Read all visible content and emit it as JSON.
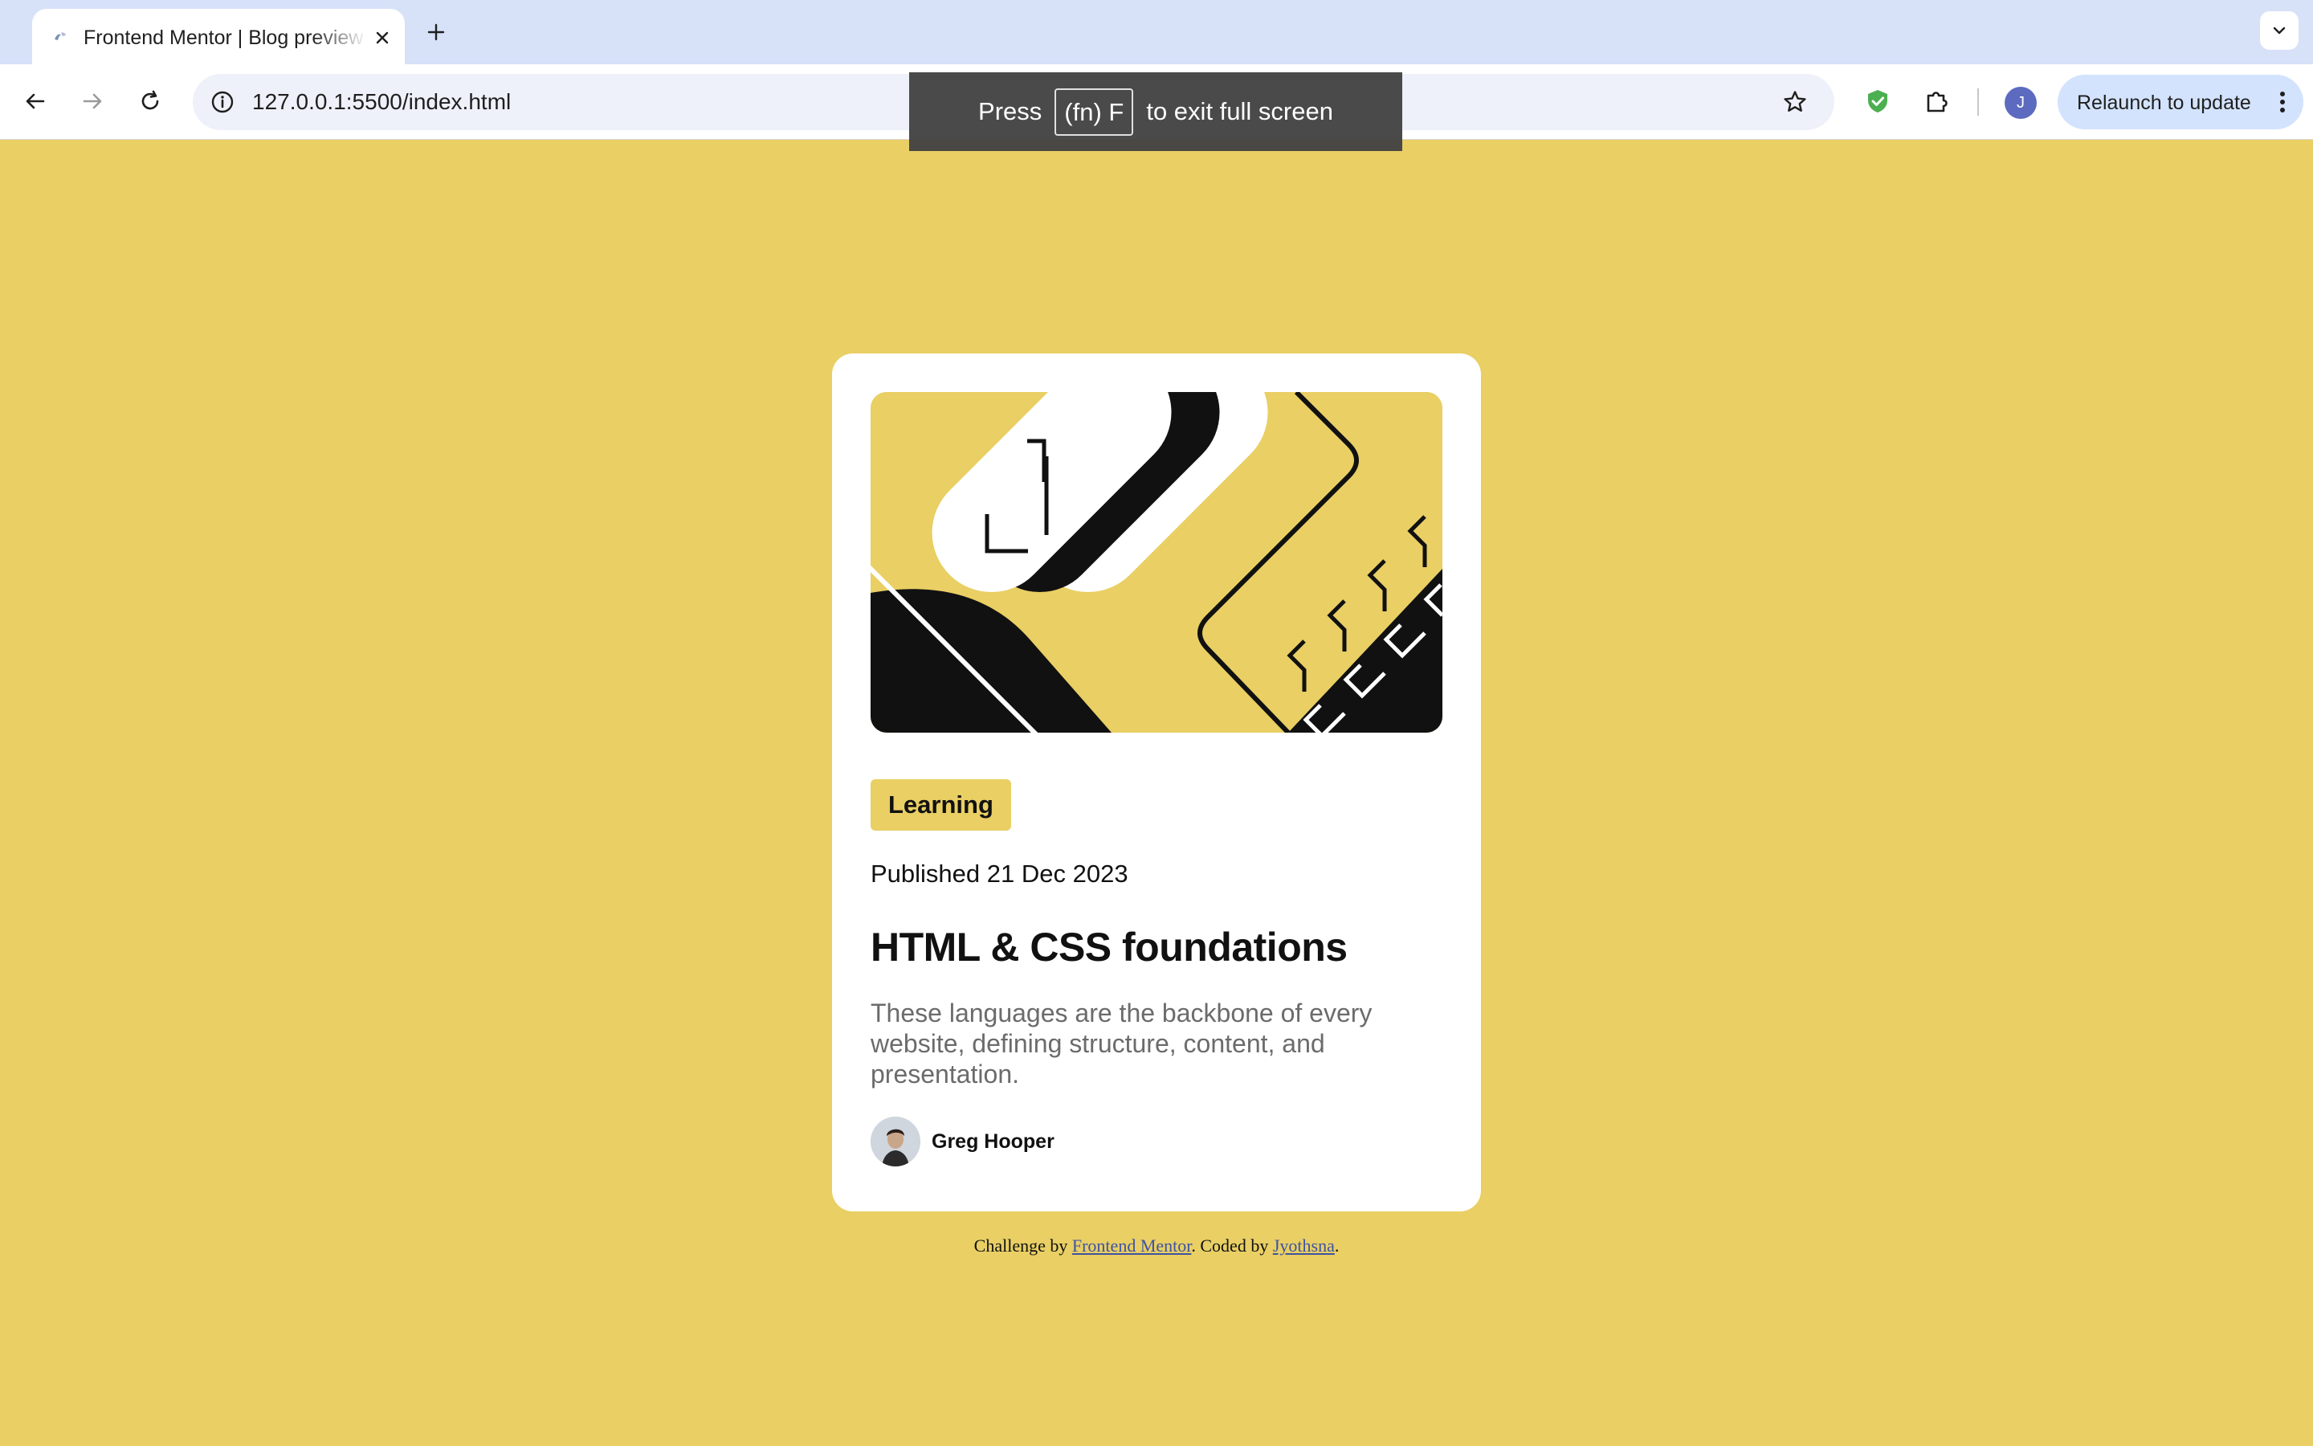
{
  "browser": {
    "tab_title": "Frontend Mentor | Blog preview card main",
    "url": "127.0.0.1:5500/index.html",
    "profile_initial": "J",
    "relaunch_label": "Relaunch to update"
  },
  "fullscreen_toast": {
    "press": "Press",
    "key": "(fn) F",
    "rest": "to exit full screen"
  },
  "card": {
    "tag": "Learning",
    "published": "Published 21 Dec 2023",
    "title": "HTML & CSS foundations",
    "excerpt": "These languages are the backbone of every website, defining structure, content, and presentation.",
    "author": "Greg Hooper"
  },
  "attribution": {
    "prefix": "Challenge by",
    "link1": "Frontend Mentor",
    "middle": ". Coded by",
    "link2": "Jyothsna",
    "suffix": "."
  },
  "colors": {
    "page_background": "#e9cf64",
    "card_background": "#ffffff",
    "tag_background": "#e9cf64",
    "text_primary": "#111111",
    "text_muted": "#6b6b6b"
  },
  "icons": [
    "favicon-icon",
    "close-icon",
    "plus-icon",
    "chevron-down-icon",
    "back-arrow-icon",
    "forward-arrow-icon",
    "reload-icon",
    "info-icon",
    "star-icon",
    "shield-icon",
    "extensions-icon",
    "more-vert-icon"
  ]
}
